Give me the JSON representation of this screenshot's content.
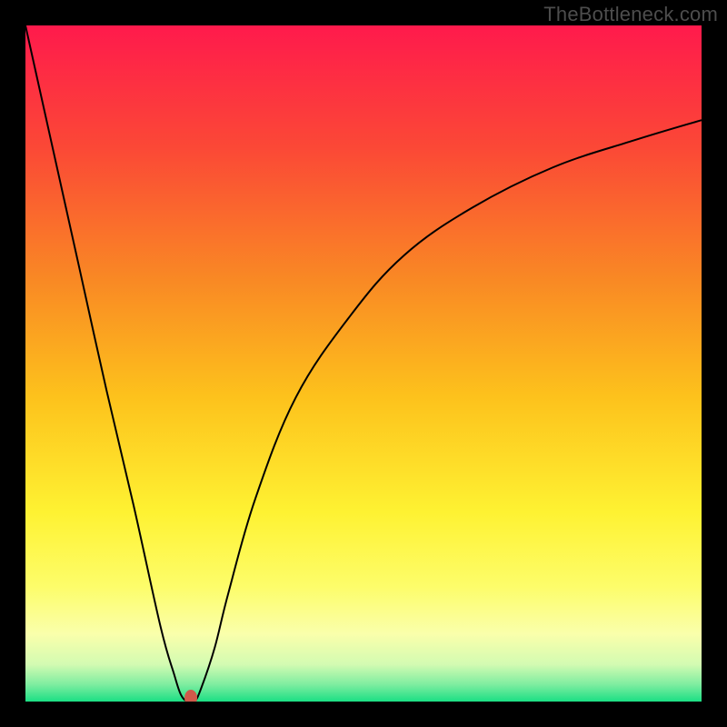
{
  "watermark": "TheBottleneck.com",
  "colors": {
    "bg_border": "#000000",
    "curve": "#000000",
    "marker": "#cf5a4a",
    "watermark_text": "#4d4d4d",
    "gradient_stops": [
      {
        "pos": 0.0,
        "color": "#ff1a4c"
      },
      {
        "pos": 0.18,
        "color": "#fb4836"
      },
      {
        "pos": 0.38,
        "color": "#f98a24"
      },
      {
        "pos": 0.55,
        "color": "#fdc21c"
      },
      {
        "pos": 0.72,
        "color": "#fef232"
      },
      {
        "pos": 0.83,
        "color": "#fdfd6a"
      },
      {
        "pos": 0.9,
        "color": "#faffab"
      },
      {
        "pos": 0.945,
        "color": "#d3fbb2"
      },
      {
        "pos": 0.975,
        "color": "#7eeda0"
      },
      {
        "pos": 1.0,
        "color": "#1bdf84"
      }
    ]
  },
  "chart_data": {
    "type": "line",
    "title": "",
    "xlabel": "",
    "ylabel": "",
    "xlim": [
      0,
      100
    ],
    "ylim": [
      0,
      100
    ],
    "series": [
      {
        "name": "bottleneck-curve",
        "x": [
          0,
          4,
          8,
          12,
          16,
          20,
          22,
          23,
          24,
          25,
          26,
          28,
          30,
          34,
          40,
          48,
          56,
          66,
          78,
          90,
          100
        ],
        "y": [
          100,
          82,
          64,
          46,
          29,
          11,
          4,
          1,
          0,
          0,
          2,
          8,
          16,
          30,
          45,
          57,
          66,
          73,
          79,
          83,
          86
        ]
      }
    ],
    "marker": {
      "x": 24.5,
      "y": 0.5,
      "color": "#cf5a4a"
    },
    "annotations": []
  }
}
